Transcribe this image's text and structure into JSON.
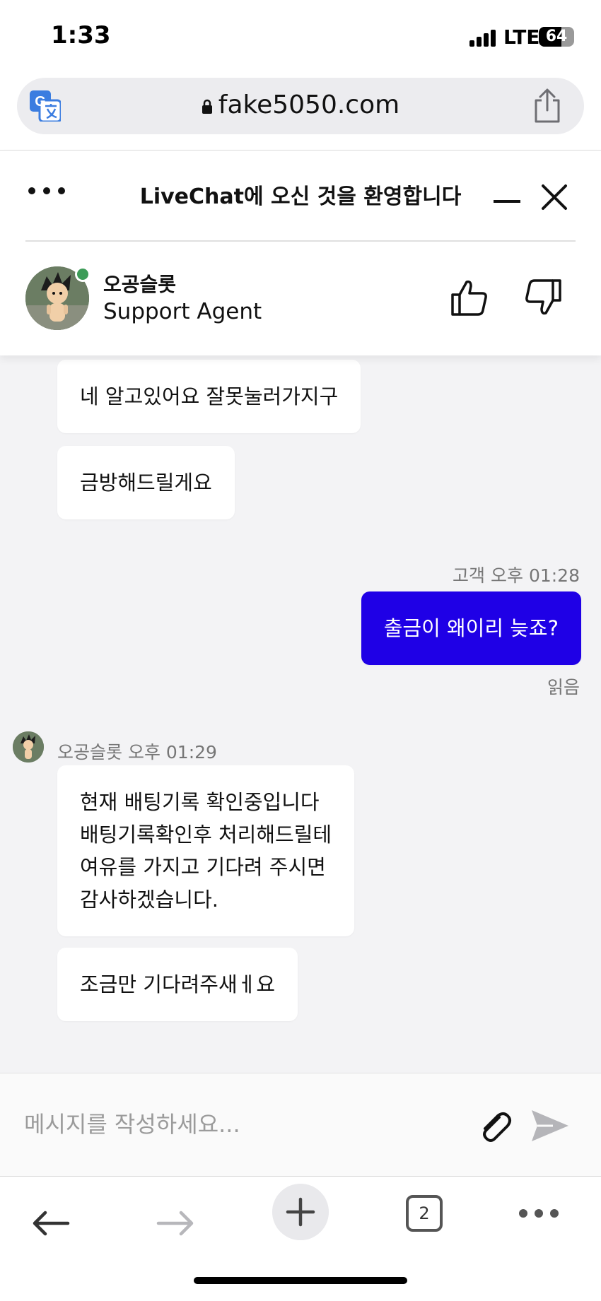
{
  "status_bar": {
    "time": "1:33",
    "network": "LTE",
    "battery": "64",
    "battery_level": 0.64
  },
  "browser": {
    "url": "fake5050.com",
    "open_tabs": "2"
  },
  "chat_header": {
    "title": "LiveChat에 오신 것을 환영합니다",
    "agent_name": "오공슬롯",
    "agent_role": "Support Agent",
    "online_color": "#3c9b57"
  },
  "messages": {
    "agent_block_1": [
      "네 알고있어요 잘못눌러가지구",
      "금방해드릴게요"
    ],
    "customer_meta": "고객 오후 01:28",
    "customer_message": "출금이 왜이리 늦죠?",
    "read_status": "읽음",
    "agent_meta": "오공슬롯 오후 01:29",
    "agent_block_2": {
      "lines": [
        "현재 배팅기록 확인중입니다",
        "배팅기록확인후 처리해드릴테",
        "여유를 가지고 기다려 주시면",
        "감사하겠습니다."
      ],
      "followup": "조금만 기다려주새ㅔ요"
    }
  },
  "composer": {
    "placeholder": "메시지를 작성하세요..."
  },
  "colors": {
    "user_bubble": "#1f00e6",
    "conversation_bg": "#f3f3f5"
  }
}
